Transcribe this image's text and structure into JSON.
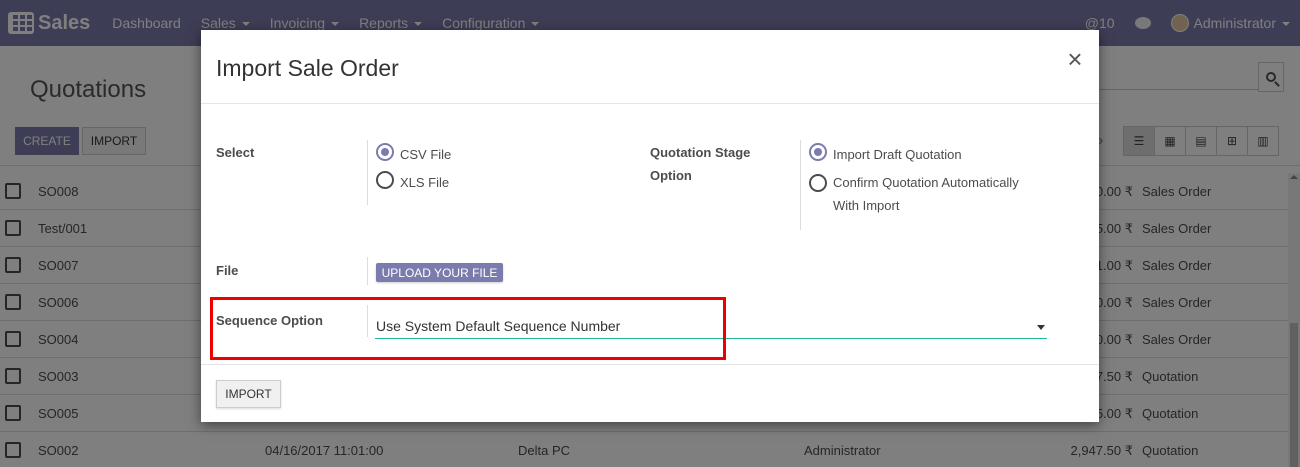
{
  "navbar": {
    "app_title": "Sales",
    "menu": [
      {
        "label": "Dashboard",
        "dropdown": false
      },
      {
        "label": "Sales",
        "dropdown": true
      },
      {
        "label": "Invoicing",
        "dropdown": true
      },
      {
        "label": "Reports",
        "dropdown": true
      },
      {
        "label": "Configuration",
        "dropdown": true
      }
    ],
    "mention_count": "@10",
    "user": "Administrator"
  },
  "control_panel": {
    "title": "Quotations",
    "create_label": "CREATE",
    "import_label": "IMPORT"
  },
  "list": {
    "rows": [
      {
        "number": "SO008",
        "date": "",
        "customer": "",
        "salesperson": "",
        "total": "0.00 ₹",
        "status": "Sales Order"
      },
      {
        "number": "Test/001",
        "date": "",
        "customer": "",
        "salesperson": "",
        "total": "5.00 ₹",
        "status": "Sales Order"
      },
      {
        "number": "SO007",
        "date": "",
        "customer": "",
        "salesperson": "",
        "total": "1.00 ₹",
        "status": "Sales Order"
      },
      {
        "number": "SO006",
        "date": "",
        "customer": "",
        "salesperson": "",
        "total": "0.00 ₹",
        "status": "Sales Order"
      },
      {
        "number": "SO004",
        "date": "",
        "customer": "",
        "salesperson": "",
        "total": "0.00 ₹",
        "status": "Sales Order"
      },
      {
        "number": "SO003",
        "date": "",
        "customer": "",
        "salesperson": "",
        "total": "7.50 ₹",
        "status": "Quotation"
      },
      {
        "number": "SO005",
        "date": "",
        "customer": "",
        "salesperson": "",
        "total": "5.00 ₹",
        "status": "Quotation"
      },
      {
        "number": "SO002",
        "date": "04/16/2017 11:01:00",
        "customer": "Delta PC",
        "salesperson": "Administrator",
        "total": "2,947.50 ₹",
        "status": "Quotation"
      }
    ]
  },
  "modal": {
    "title": "Import Sale Order",
    "close_symbol": "×",
    "select_label": "Select",
    "select_options": [
      {
        "label": "CSV File",
        "checked": true
      },
      {
        "label": "XLS File",
        "checked": false
      }
    ],
    "stage_label_line1": "Quotation Stage",
    "stage_label_line2": "Option",
    "stage_options": [
      {
        "label": "Import Draft Quotation",
        "checked": true
      },
      {
        "label_line1": "Confirm Quotation Automatically",
        "label_line2": "With Import",
        "checked": false
      }
    ],
    "file_label": "File",
    "upload_label": "UPLOAD YOUR FILE",
    "sequence_label": "Sequence Option",
    "sequence_value": "Use System Default Sequence Number",
    "import_button": "IMPORT"
  },
  "colors": {
    "brand": "#7c7bad",
    "highlight": "#ee0000",
    "select_underline": "#21b799"
  }
}
